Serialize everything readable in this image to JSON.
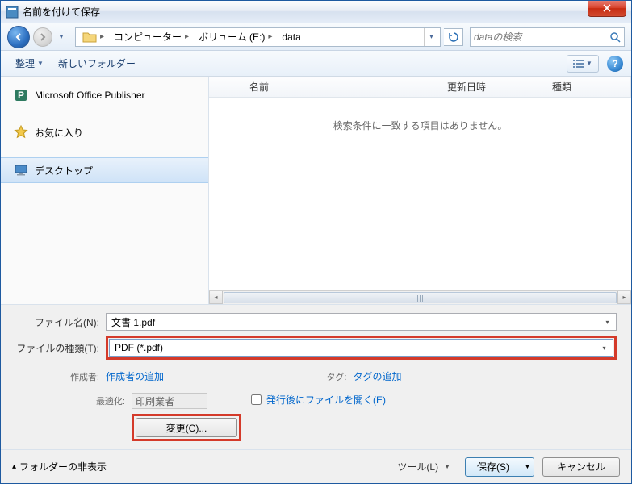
{
  "window": {
    "title": "名前を付けて保存"
  },
  "nav": {
    "breadcrumb": [
      "コンピューター",
      "ボリューム (E:)",
      "data"
    ],
    "search_placeholder": "dataの検索"
  },
  "toolbar": {
    "organize": "整理",
    "new_folder": "新しいフォルダー"
  },
  "sidebar": {
    "items": [
      {
        "label": "Microsoft Office Publisher",
        "icon": "publisher"
      },
      {
        "label": "お気に入り",
        "icon": "star"
      },
      {
        "label": "デスクトップ",
        "icon": "desktop"
      }
    ]
  },
  "columns": {
    "name": "名前",
    "date": "更新日時",
    "type": "種類"
  },
  "empty_text": "検索条件に一致する項目はありません。",
  "filename": {
    "label": "ファイル名(N):",
    "value": "文書 1.pdf"
  },
  "filetype": {
    "label": "ファイルの種類(T):",
    "value": "PDF (*.pdf)"
  },
  "meta": {
    "author_label": "作成者:",
    "author_link": "作成者の追加",
    "tag_label": "タグ:",
    "tag_link": "タグの追加"
  },
  "optimize": {
    "label": "最適化:",
    "value": "印刷業者",
    "change_btn": "変更(C)..."
  },
  "open_after": {
    "label": "発行後にファイルを開く(E)",
    "checked": false
  },
  "footer": {
    "hide_folders": "フォルダーの非表示",
    "tools": "ツール(L)",
    "save": "保存(S)",
    "cancel": "キャンセル"
  }
}
